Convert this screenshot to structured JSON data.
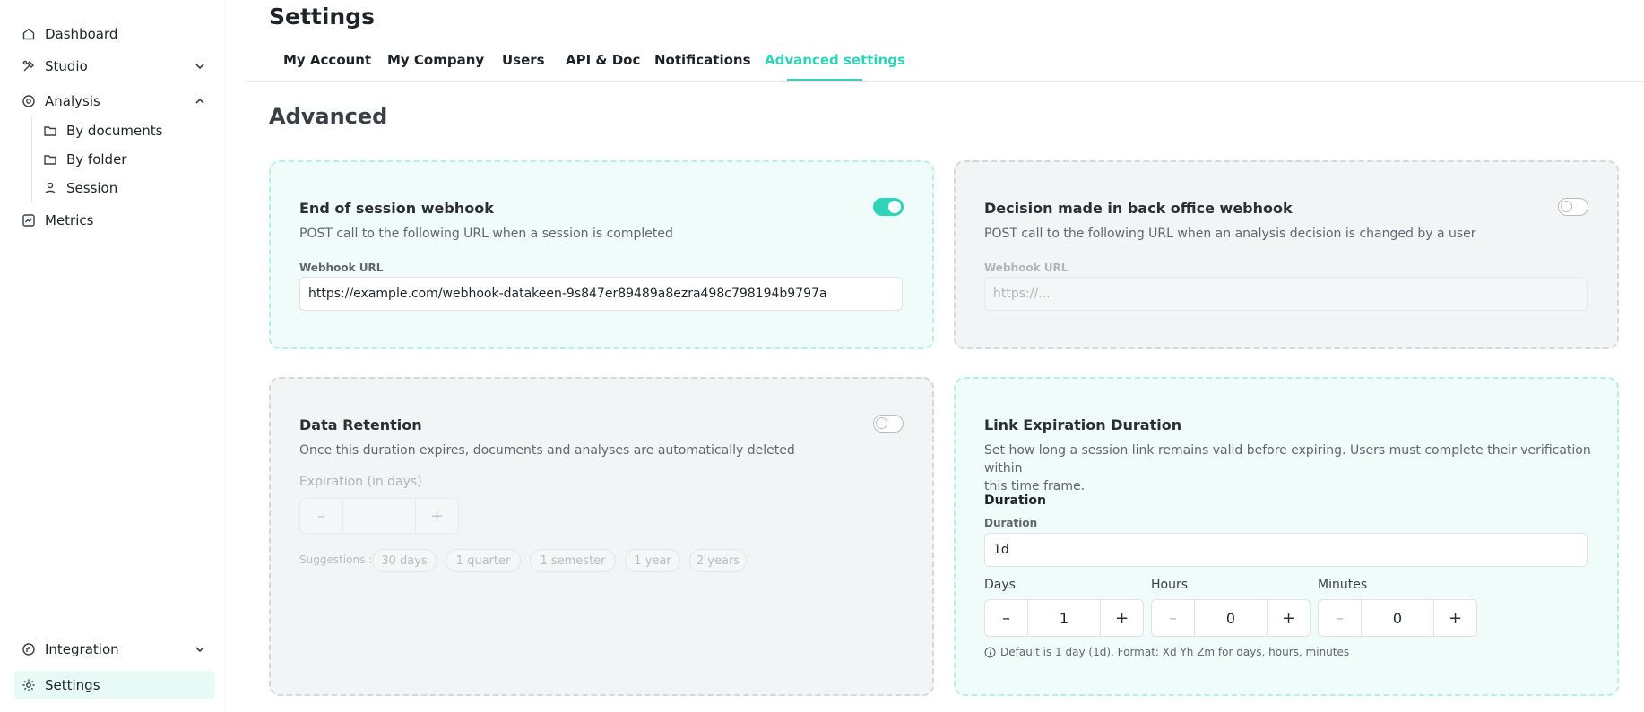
{
  "sidebar": {
    "items": [
      {
        "label": "Dashboard"
      },
      {
        "label": "Studio"
      },
      {
        "label": "Analysis"
      },
      {
        "label": "Metrics"
      },
      {
        "label": "Integration"
      },
      {
        "label": "Settings"
      }
    ],
    "analysis_sub": [
      {
        "label": "By documents"
      },
      {
        "label": "By folder"
      },
      {
        "label": "Session"
      }
    ]
  },
  "page": {
    "title": "Settings",
    "tabs": [
      {
        "label": "My Account"
      },
      {
        "label": "My Company"
      },
      {
        "label": "Users"
      },
      {
        "label": "API & Doc"
      },
      {
        "label": "Notifications"
      },
      {
        "label": "Advanced settings"
      }
    ],
    "active_tab": "Advanced settings",
    "section_title": "Advanced"
  },
  "cards": {
    "session_webhook": {
      "title": "End of session webhook",
      "description": "POST call to the following URL when a session is completed",
      "enabled": true,
      "field_label": "Webhook URL",
      "value": "https://example.com/webhook-datakeen-9s847er89489a8ezra498c798194b9797a"
    },
    "decision_webhook": {
      "title": "Decision made in back office webhook",
      "description": "POST call to the following URL when an analysis decision is changed by a user",
      "enabled": false,
      "field_label": "Webhook URL",
      "placeholder": "https://..."
    },
    "data_retention": {
      "title": "Data Retention",
      "description": "Once this duration expires, documents and analyses are automatically deleted",
      "enabled": false,
      "expiration_label": "Expiration (in days)",
      "minus": "–",
      "plus": "+",
      "suggestions_label": "Suggestions :",
      "suggestions": [
        "30 days",
        "1 quarter",
        "1 semester",
        "1 year",
        "2 years"
      ]
    },
    "link_expiration": {
      "title": "Link Expiration Duration",
      "description_line1": "Set how long a session link remains valid before expiring. Users must complete their verification within",
      "description_line2": "this time frame.",
      "section_label": "Duration",
      "field_label": "Duration",
      "value": "1d",
      "days_label": "Days",
      "days_value": "1",
      "hours_label": "Hours",
      "hours_value": "0",
      "minutes_label": "Minutes",
      "minutes_value": "0",
      "minus": "–",
      "plus": "+",
      "note": "Default is 1 day (1d). Format: Xd Yh Zm for days, hours, minutes"
    }
  },
  "colors": {
    "accent": "#2fd3b8",
    "card_on_bg": "#effcf9",
    "card_off_bg": "#f3f4f6"
  }
}
